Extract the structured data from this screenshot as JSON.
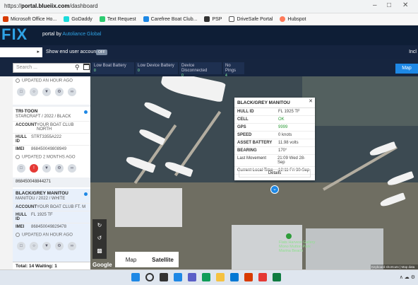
{
  "browser": {
    "url_prefix": "https://",
    "url_host": "portal.blueiix.com",
    "url_path": "/dashboard",
    "window_controls": [
      "–",
      "□",
      "✕"
    ]
  },
  "bookmarks": [
    {
      "label": "Microsoft Office Ho...",
      "color": "#d83b01"
    },
    {
      "label": "GoDaddy",
      "color": "#1bdbdb"
    },
    {
      "label": "Text Request",
      "color": "#2ecc71"
    },
    {
      "label": "Carefree Boat Club...",
      "color": "#1e88e5"
    },
    {
      "label": "PSP",
      "color": "#333333"
    },
    {
      "label": "DriveSafe Portal",
      "color": "#555555"
    },
    {
      "label": "Hubspot",
      "color": "#ff7a59"
    }
  ],
  "header": {
    "logo": "FIX",
    "portal_by": "portal by",
    "portal_brand": "Autoliance Global"
  },
  "subheader": {
    "account_value": "",
    "show_end_user_label": "Show end user accounts",
    "toggle_label": "OFF",
    "right_label": "Incl"
  },
  "filters": {
    "search_placeholder": "Search ...",
    "chips": [
      {
        "label": "Low Boat Battery",
        "count": "0"
      },
      {
        "label": "Low Device Battery",
        "count": "0"
      },
      {
        "label": "Device Disconnected",
        "count": "0"
      },
      {
        "label": "No Pings",
        "count": "4"
      }
    ],
    "map_button": "Map"
  },
  "panel": {
    "card1": {
      "updated": "UPDATED AN HOUR AGO"
    },
    "card2": {
      "name": "TRI-TOON",
      "sub": "STARCRAFT / 2022 / BLACK",
      "account_label": "ACCOUNT",
      "account_value": "YOUR BOAT CLUB NORTH",
      "hull_label": "HULL ID",
      "hull_value": "STRT3355A222",
      "imei_label": "IMEI",
      "imei_value": "868450049808949",
      "updated": "UPDATED 2 MONTHS AGO"
    },
    "separator": "868450048844271",
    "card3": {
      "name": "BLACK/GREY MANITOU",
      "sub": "MANITOU / 2022 / WHITE",
      "account_label": "ACCOUNT",
      "account_value": "YOUR BOAT CLUB FT. M",
      "hull_label": "HULL ID",
      "hull_value": "FL 1925 TF",
      "imei_label": "IMEI",
      "imei_value": "868450049829478",
      "updated": "UPDATED AN HOUR AGO"
    },
    "footer": "Total: 14  Waiting: 1"
  },
  "popup": {
    "title": "BLACK/GREY MANITOU",
    "rows": [
      {
        "k": "HULL ID",
        "v": "FL 1925 TF",
        "style": ""
      },
      {
        "k": "CELL",
        "v": "OK",
        "style": "green"
      },
      {
        "k": "GPS",
        "v": "9999",
        "style": "green"
      },
      {
        "k": "SPEED",
        "v": "0 knots",
        "style": ""
      },
      {
        "k": "ASSET BATTERY",
        "v": "11.98 volts",
        "style": ""
      },
      {
        "k": "BEARING",
        "v": "170°",
        "style": ""
      },
      {
        "k": "Last Movement",
        "v": "21:09 Wed 28-Sep",
        "style": "light"
      },
      {
        "k": "Current Local Time",
        "v": "12:11 Fri 30-Sep",
        "style": "light"
      }
    ],
    "details_button": "Details",
    "close": "✕"
  },
  "map": {
    "type_map": "Map",
    "type_satellite": "Satellite",
    "google": "Google",
    "attribution": "Keyboard shortcuts | Map data ©",
    "poi_label": "Flats Harvest Gallery Mono Mutton Park Marina Beach"
  },
  "taskbar": {
    "tray_text": "∧  ☁  ⚙"
  }
}
